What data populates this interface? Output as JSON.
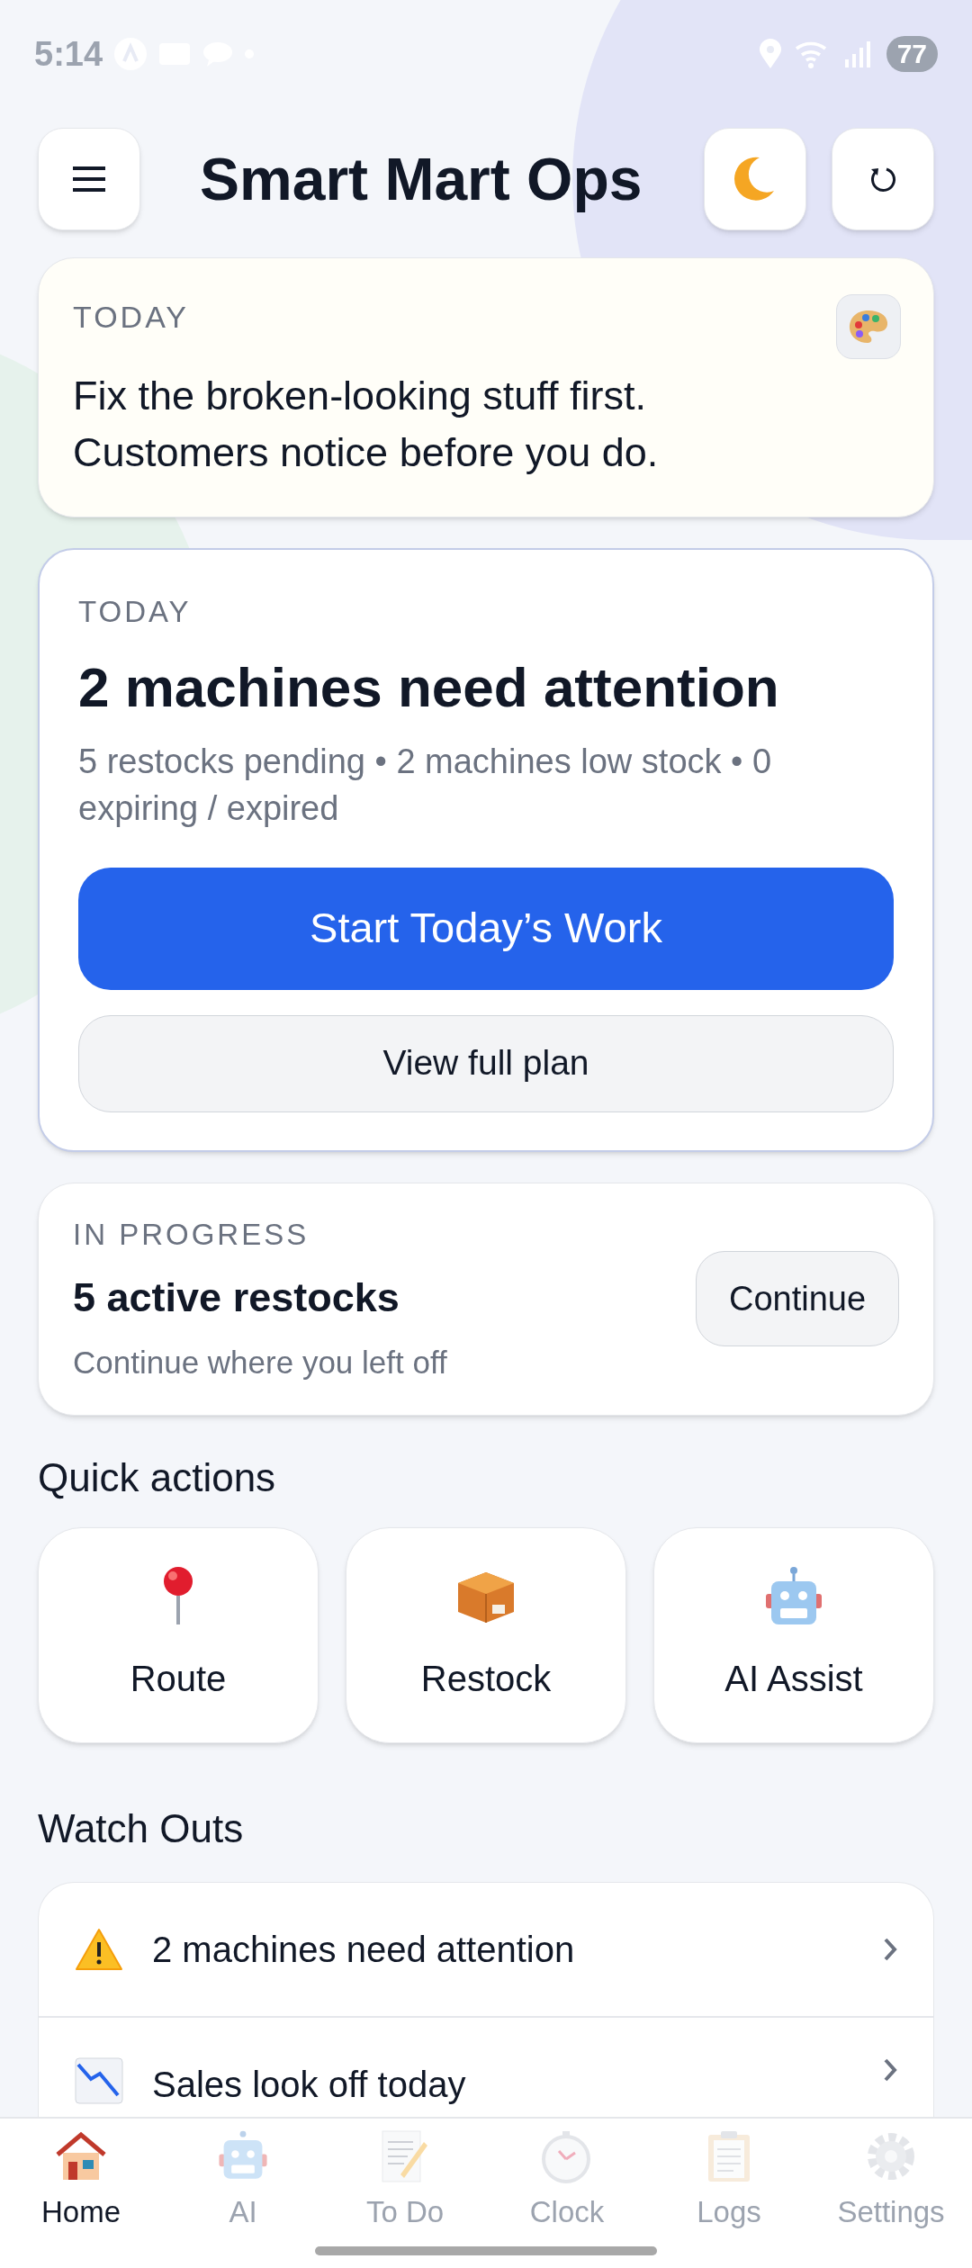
{
  "status_bar": {
    "time": "5:14",
    "battery": "77"
  },
  "header": {
    "title": "Smart Mart Ops"
  },
  "tip_card": {
    "label": "TODAY",
    "text": "Fix the broken-looking stuff first. Customers notice before you do."
  },
  "summary_card": {
    "label": "TODAY",
    "title": "2 machines need attention",
    "subtitle": "5 restocks pending • 2 machines low stock • 0 expiring / expired",
    "primary_button": "Start Today’s Work",
    "secondary_button": "View full plan"
  },
  "progress_card": {
    "label": "IN PROGRESS",
    "title": "5 active restocks",
    "subtitle": "Continue where you left off",
    "button": "Continue"
  },
  "quick_actions": {
    "heading": "Quick actions",
    "items": [
      {
        "label": "Route"
      },
      {
        "label": "Restock"
      },
      {
        "label": "AI Assist"
      }
    ]
  },
  "watch_outs": {
    "heading": "Watch Outs",
    "items": [
      {
        "text": "2 machines need attention"
      },
      {
        "text": "Sales look off today"
      }
    ]
  },
  "bottom_nav": [
    {
      "label": "Home",
      "selected": true
    },
    {
      "label": "AI",
      "selected": false
    },
    {
      "label": "To Do",
      "selected": false
    },
    {
      "label": "Clock",
      "selected": false
    },
    {
      "label": "Logs",
      "selected": false
    },
    {
      "label": "Settings",
      "selected": false
    }
  ]
}
